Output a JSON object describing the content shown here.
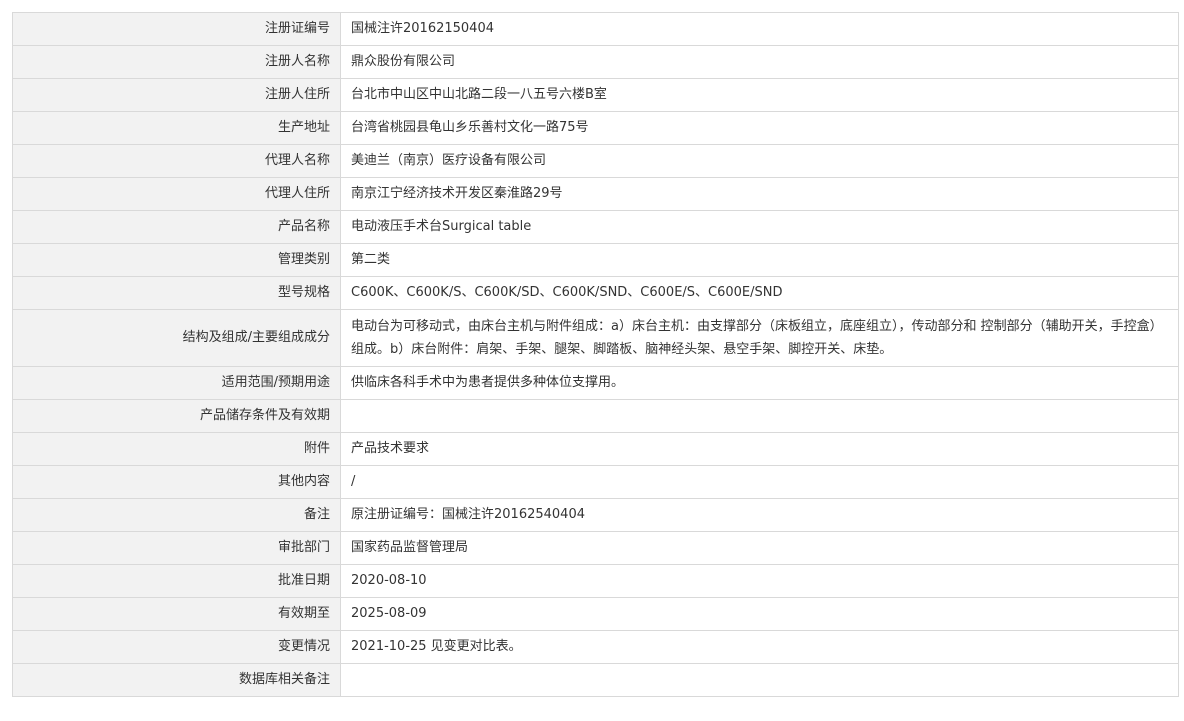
{
  "rows": [
    {
      "label": "注册证编号",
      "value": "国械注许20162150404"
    },
    {
      "label": "注册人名称",
      "value": "鼎众股份有限公司"
    },
    {
      "label": "注册人住所",
      "value": "台北市中山区中山北路二段一八五号六楼B室"
    },
    {
      "label": "生产地址",
      "value": "台湾省桃园县龟山乡乐善村文化一路75号"
    },
    {
      "label": "代理人名称",
      "value": "美迪兰（南京）医疗设备有限公司"
    },
    {
      "label": "代理人住所",
      "value": "南京江宁经济技术开发区秦淮路29号"
    },
    {
      "label": "产品名称",
      "value": "电动液压手术台Surgical table"
    },
    {
      "label": "管理类别",
      "value": "第二类"
    },
    {
      "label": "型号规格",
      "value": "C600K、C600K/S、C600K/SD、C600K/SND、C600E/S、C600E/SND"
    },
    {
      "label": "结构及组成/主要组成成分",
      "value": "电动台为可移动式，由床台主机与附件组成：a）床台主机：由支撑部分（床板组立，底座组立），传动部分和 控制部分（辅助开关，手控盒）组成。b）床台附件：肩架、手架、腿架、脚踏板、脑神经头架、悬空手架、脚控开关、床垫。"
    },
    {
      "label": "适用范围/预期用途",
      "value": "供临床各科手术中为患者提供多种体位支撑用。"
    },
    {
      "label": "产品储存条件及有效期",
      "value": ""
    },
    {
      "label": "附件",
      "value": "产品技术要求"
    },
    {
      "label": "其他内容",
      "value": "/"
    },
    {
      "label": "备注",
      "value": "原注册证编号：国械注许20162540404"
    },
    {
      "label": "审批部门",
      "value": "国家药品监督管理局"
    },
    {
      "label": "批准日期",
      "value": "2020-08-10"
    },
    {
      "label": "有效期至",
      "value": "2025-08-09"
    },
    {
      "label": "变更情况",
      "value": "2021-10-25 见变更对比表。"
    },
    {
      "label": "数据库相关备注",
      "value": ""
    }
  ]
}
